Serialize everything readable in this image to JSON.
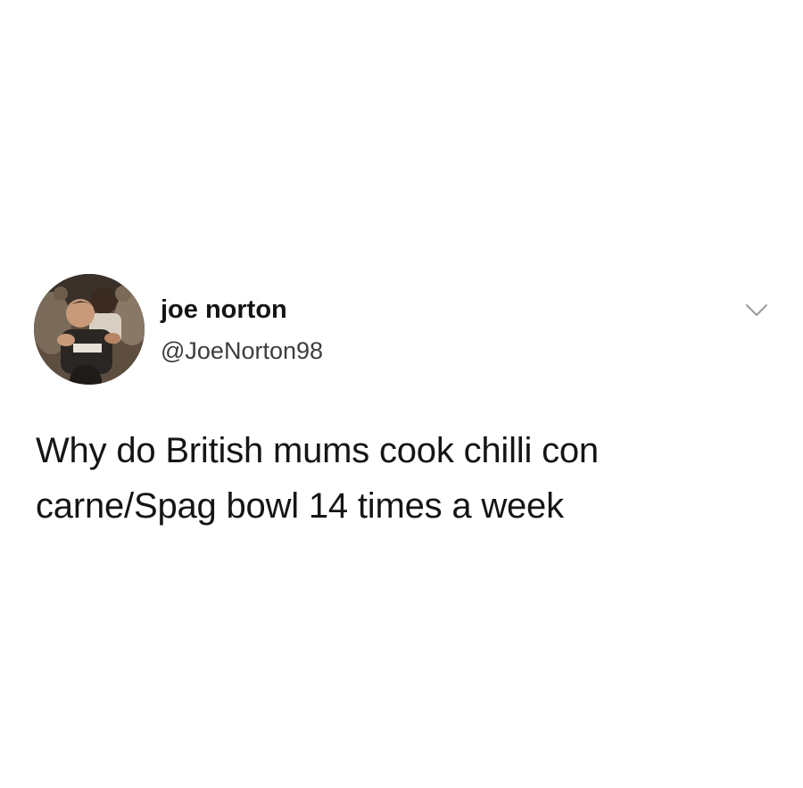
{
  "tweet": {
    "author": {
      "display_name": "joe norton",
      "handle": "@JoeNorton98",
      "avatar_icon": "profile-photo"
    },
    "menu_icon": "chevron-down-icon",
    "text_lines": [
      "Why do British mums cook chilli con",
      "carne/Spag bowl 14 times a week"
    ]
  },
  "colors": {
    "background": "#ffffff",
    "text": "#151515",
    "handle": "#3d3d3d",
    "chevron": "#9a9a9a"
  }
}
